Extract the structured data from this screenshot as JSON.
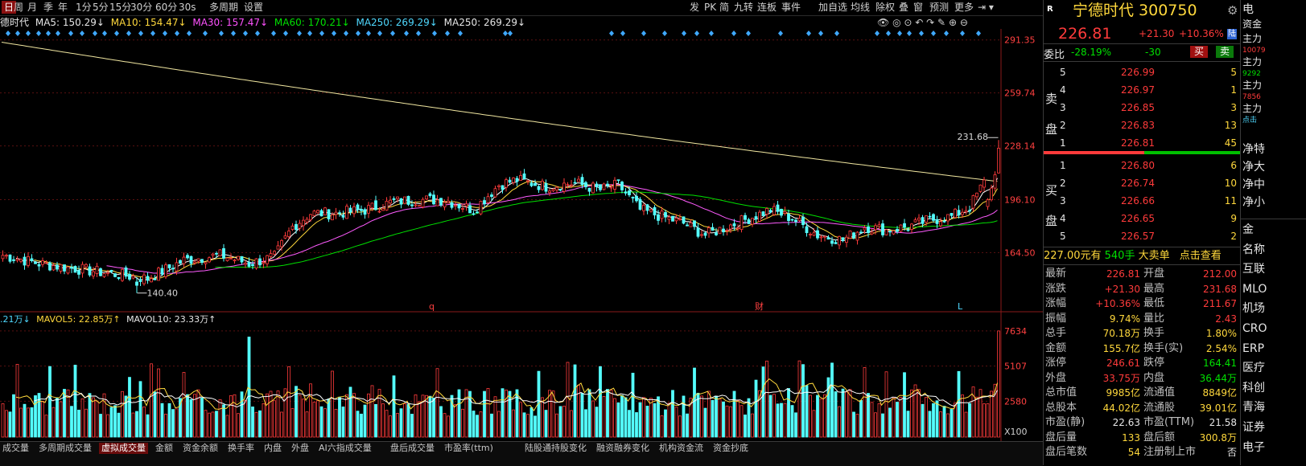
{
  "toolbar": {
    "items": [
      "日",
      "周",
      "月",
      "季",
      "年",
      "1分",
      "5分",
      "15分",
      "30分",
      "60分",
      "30s",
      "多周期",
      "设置"
    ],
    "active": 0,
    "right_items": [
      "发",
      "PK",
      "简",
      "九转",
      "连板",
      "事件",
      "加自选",
      "均线",
      "除权",
      "叠",
      "窗",
      "预测",
      "更多"
    ]
  },
  "ma_line": {
    "name": "德时代",
    "ma5": "MA5: 150.29↓",
    "ma10": "MA10: 154.47↓",
    "ma30": "MA30: 157.47↓",
    "ma60": "MA60: 170.21↓",
    "ma250a": "MA250: 269.29↓",
    "ma250b": "MA250: 269.29↓"
  },
  "vol_line": {
    "vol": ".21万↓",
    "mavol5": "MAVOL5: 22.85万↑",
    "mavol10": "MAVOL10: 23.33万↑"
  },
  "bottom_tabs": [
    "成交量",
    "多周期成交量",
    "虚拟成交量",
    "金额",
    "资金余额",
    "换手率",
    "内盘",
    "外盘",
    "AI六指成交量",
    "盘后成交量",
    "市盈率(ttm)",
    "陆股通持股变化",
    "融资融券变化",
    "机构资金流",
    "资金抄底"
  ],
  "bottom_active": 2,
  "stock": {
    "tag": "R",
    "name": "宁德时代 300750",
    "price": "226.81",
    "change": "+21.30",
    "pct": "+10.36%",
    "badge": "陆"
  },
  "weibi": {
    "label": "委比",
    "value": "-28.19%",
    "diff": "-30",
    "buy": "买",
    "sell": "卖"
  },
  "asks": [
    {
      "level": "5",
      "price": "226.99",
      "vol": "5"
    },
    {
      "level": "4",
      "price": "226.97",
      "vol": "1"
    },
    {
      "level": "3",
      "price": "226.85",
      "vol": "3"
    },
    {
      "level": "2",
      "price": "226.83",
      "vol": "13"
    },
    {
      "level": "1",
      "price": "226.81",
      "vol": "45"
    }
  ],
  "bids": [
    {
      "level": "1",
      "price": "226.80",
      "vol": "6"
    },
    {
      "level": "2",
      "price": "226.74",
      "vol": "10"
    },
    {
      "level": "3",
      "price": "226.66",
      "vol": "11"
    },
    {
      "level": "4",
      "price": "226.65",
      "vol": "9"
    },
    {
      "level": "5",
      "price": "226.57",
      "vol": "2"
    }
  ],
  "ask_label": [
    "卖",
    "盘"
  ],
  "bid_label": [
    "买",
    "盘"
  ],
  "big_order": {
    "price": "227.00元有",
    "qty": "540手",
    "label": "大卖单",
    "link": "点击查看"
  },
  "stats": [
    {
      "l1": "最新",
      "v1": "226.81",
      "c1": "red",
      "l2": "开盘",
      "v2": "212.00",
      "c2": "red"
    },
    {
      "l1": "涨跌",
      "v1": "+21.30",
      "c1": "red",
      "l2": "最高",
      "v2": "231.68",
      "c2": "red"
    },
    {
      "l1": "涨幅",
      "v1": "+10.36%",
      "c1": "red",
      "l2": "最低",
      "v2": "211.67",
      "c2": "red"
    },
    {
      "l1": "振幅",
      "v1": "9.74%",
      "c1": "yellow",
      "l2": "量比",
      "v2": "2.43",
      "c2": "red"
    },
    {
      "l1": "总手",
      "v1": "70.18万",
      "c1": "yellow",
      "l2": "换手",
      "v2": "1.80%",
      "c2": "yellow"
    },
    {
      "l1": "金额",
      "v1": "155.7亿",
      "c1": "yellow",
      "l2": "换手(实)",
      "v2": "2.54%",
      "c2": "yellow"
    },
    {
      "l1": "涨停",
      "v1": "246.61",
      "c1": "red",
      "l2": "跌停",
      "v2": "164.41",
      "c2": "green"
    },
    {
      "l1": "外盘",
      "v1": "33.75万",
      "c1": "red",
      "l2": "内盘",
      "v2": "36.44万",
      "c2": "green"
    },
    {
      "l1": "总市值",
      "v1": "9985亿",
      "c1": "yellow",
      "l2": "流通值",
      "v2": "8849亿",
      "c2": "yellow"
    },
    {
      "l1": "总股本",
      "v1": "44.02亿",
      "c1": "yellow",
      "l2": "流通股",
      "v2": "39.01亿",
      "c2": "yellow"
    },
    {
      "l1": "市盈(静)",
      "v1": "22.63",
      "c1": "white",
      "l2": "市盈(TTM)",
      "v2": "21.58",
      "c2": "white"
    },
    {
      "l1": "盘后量",
      "v1": "133",
      "c1": "yellow",
      "l2": "盘后额",
      "v2": "300.8万",
      "c2": "yellow"
    },
    {
      "l1": "盘后笔数",
      "v1": "54",
      "c1": "yellow",
      "l2": "注册制上市",
      "v2": "否",
      "c2": "white"
    }
  ],
  "far_right": {
    "top": [
      "电",
      "资金"
    ],
    "items": [
      "主力",
      "10079",
      "主力",
      "9292",
      "主力",
      "7856",
      "主力",
      "点击"
    ],
    "net": [
      "净特",
      "净大",
      "净中",
      "净小"
    ],
    "list": [
      "金",
      "名称",
      "互联",
      "MLO",
      "机场",
      "CRO",
      "ERP",
      "医疗",
      "科创",
      "青海",
      "证券",
      "电子"
    ]
  },
  "chart_data": [
    {
      "type": "candlestick",
      "title": "",
      "price_ticks": [
        "291.35",
        "259.74",
        "228.14",
        "196.10",
        "164.50"
      ],
      "ylim": [
        140.4,
        291.35
      ],
      "annotations": [
        {
          "text": "231.68",
          "kind": "high"
        },
        {
          "text": "140.40",
          "kind": "low"
        },
        {
          "text": "q",
          "kind": "marker"
        },
        {
          "text": "财",
          "kind": "marker"
        },
        {
          "text": "L",
          "kind": "marker"
        }
      ],
      "series_note": "approx daily OHLC, ~200 sessions",
      "anchors": [
        {
          "i": 0,
          "c": 163
        },
        {
          "i": 10,
          "c": 158
        },
        {
          "i": 20,
          "c": 155
        },
        {
          "i": 30,
          "c": 152
        },
        {
          "i": 40,
          "c": 149
        },
        {
          "i": 50,
          "c": 160
        },
        {
          "i": 60,
          "c": 163
        },
        {
          "i": 68,
          "c": 158
        },
        {
          "i": 75,
          "c": 162
        },
        {
          "i": 80,
          "c": 180
        },
        {
          "i": 85,
          "c": 188
        },
        {
          "i": 92,
          "c": 188
        },
        {
          "i": 100,
          "c": 190
        },
        {
          "i": 108,
          "c": 195
        },
        {
          "i": 115,
          "c": 196
        },
        {
          "i": 122,
          "c": 196
        },
        {
          "i": 130,
          "c": 190
        },
        {
          "i": 137,
          "c": 205
        },
        {
          "i": 142,
          "c": 208
        },
        {
          "i": 150,
          "c": 204
        },
        {
          "i": 158,
          "c": 206
        },
        {
          "i": 165,
          "c": 202
        },
        {
          "i": 170,
          "c": 205
        },
        {
          "i": 176,
          "c": 190
        },
        {
          "i": 182,
          "c": 186
        },
        {
          "i": 188,
          "c": 182
        },
        {
          "i": 194,
          "c": 175
        },
        {
          "i": 200,
          "c": 180
        },
        {
          "i": 206,
          "c": 185
        },
        {
          "i": 212,
          "c": 190
        },
        {
          "i": 218,
          "c": 185
        },
        {
          "i": 225,
          "c": 175
        },
        {
          "i": 232,
          "c": 172
        },
        {
          "i": 238,
          "c": 180
        },
        {
          "i": 244,
          "c": 178
        },
        {
          "i": 250,
          "c": 180
        },
        {
          "i": 256,
          "c": 184
        },
        {
          "i": 262,
          "c": 186
        },
        {
          "i": 267,
          "c": 192
        },
        {
          "i": 272,
          "c": 210
        },
        {
          "i": 275,
          "c": 227
        }
      ],
      "last_candle": {
        "o": 212.0,
        "h": 231.68,
        "l": 211.67,
        "c": 226.81
      }
    },
    {
      "type": "bar",
      "title": "volume",
      "volume_ticks": [
        "7634",
        "5107",
        "2580",
        "X100"
      ],
      "ylim": [
        0,
        7634
      ]
    }
  ],
  "colors": {
    "up": "#ff3b3b",
    "down": "#54ffff",
    "ma5": "#ffffff",
    "ma10": "#ffd83c",
    "ma30": "#ff5bff",
    "ma60": "#00e000",
    "ma250": "#f0e6a0",
    "grid": "#5a1010",
    "axis": "#8a1a1a"
  }
}
